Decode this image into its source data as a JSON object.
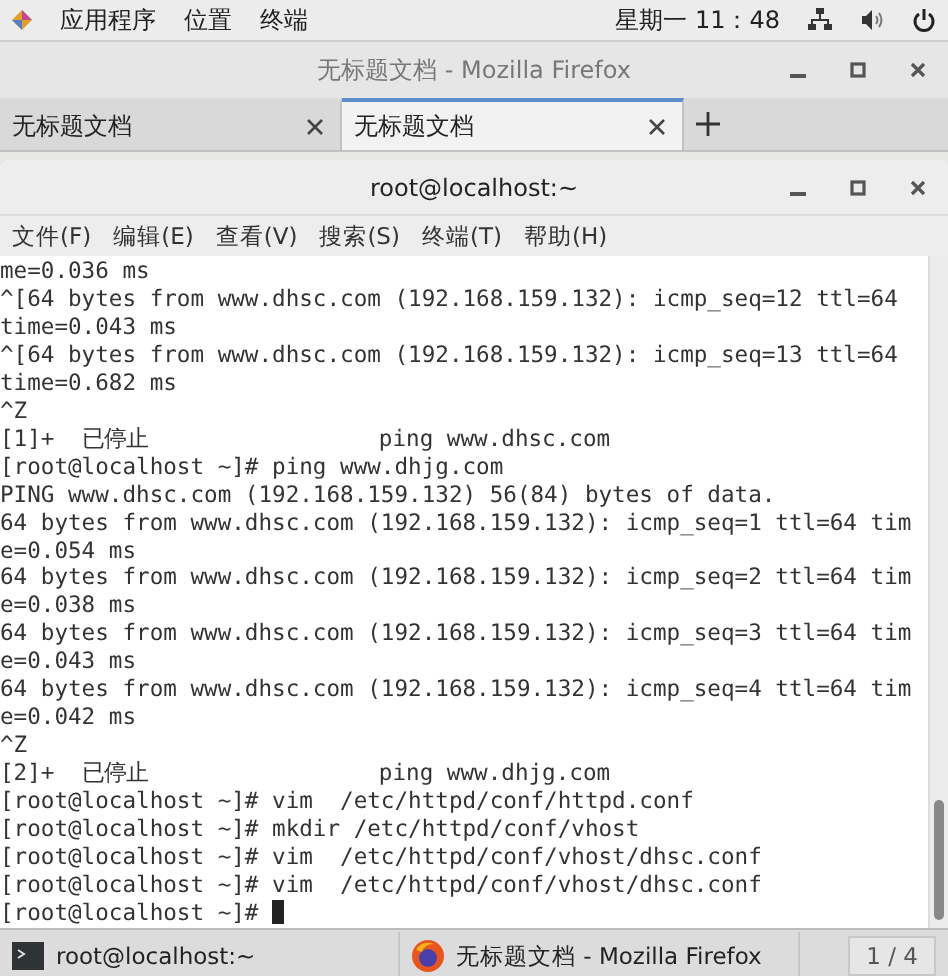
{
  "top_bar": {
    "menus": [
      "应用程序",
      "位置",
      "终端"
    ],
    "clock": "星期一 11：48"
  },
  "browser": {
    "title": "无标题文档 - Mozilla Firefox",
    "tabs": [
      {
        "label": "无标题文档",
        "selected": false
      },
      {
        "label": "无标题文档",
        "selected": true
      }
    ]
  },
  "terminal": {
    "title": "root@localhost:~",
    "menu": [
      "文件(F)",
      "编辑(E)",
      "查看(V)",
      "搜索(S)",
      "终端(T)",
      "帮助(H)"
    ],
    "lines": [
      "me=0.036 ms",
      "^[64 bytes from www.dhsc.com (192.168.159.132): icmp_seq=12 ttl=64",
      "time=0.043 ms",
      "^[64 bytes from www.dhsc.com (192.168.159.132): icmp_seq=13 ttl=64",
      "time=0.682 ms",
      "^Z",
      "[1]+  已停止                 ping www.dhsc.com",
      "[root@localhost ~]# ping www.dhjg.com",
      "PING www.dhsc.com (192.168.159.132) 56(84) bytes of data.",
      "64 bytes from www.dhsc.com (192.168.159.132): icmp_seq=1 ttl=64 tim",
      "e=0.054 ms",
      "64 bytes from www.dhsc.com (192.168.159.132): icmp_seq=2 ttl=64 tim",
      "e=0.038 ms",
      "64 bytes from www.dhsc.com (192.168.159.132): icmp_seq=3 ttl=64 tim",
      "e=0.043 ms",
      "64 bytes from www.dhsc.com (192.168.159.132): icmp_seq=4 ttl=64 tim",
      "e=0.042 ms",
      "^Z",
      "[2]+  已停止                 ping www.dhjg.com",
      "[root@localhost ~]# vim  /etc/httpd/conf/httpd.conf",
      "[root@localhost ~]# mkdir /etc/httpd/conf/vhost",
      "[root@localhost ~]# vim  /etc/httpd/conf/vhost/dhsc.conf",
      "[root@localhost ~]# vim  /etc/httpd/conf/vhost/dhsc.conf",
      "[root@localhost ~]# "
    ]
  },
  "taskbar": {
    "items": [
      {
        "kind": "terminal",
        "label": "root@localhost:~"
      },
      {
        "kind": "firefox",
        "label": "无标题文档 - Mozilla Firefox"
      }
    ],
    "workspace": "1 / 4"
  }
}
